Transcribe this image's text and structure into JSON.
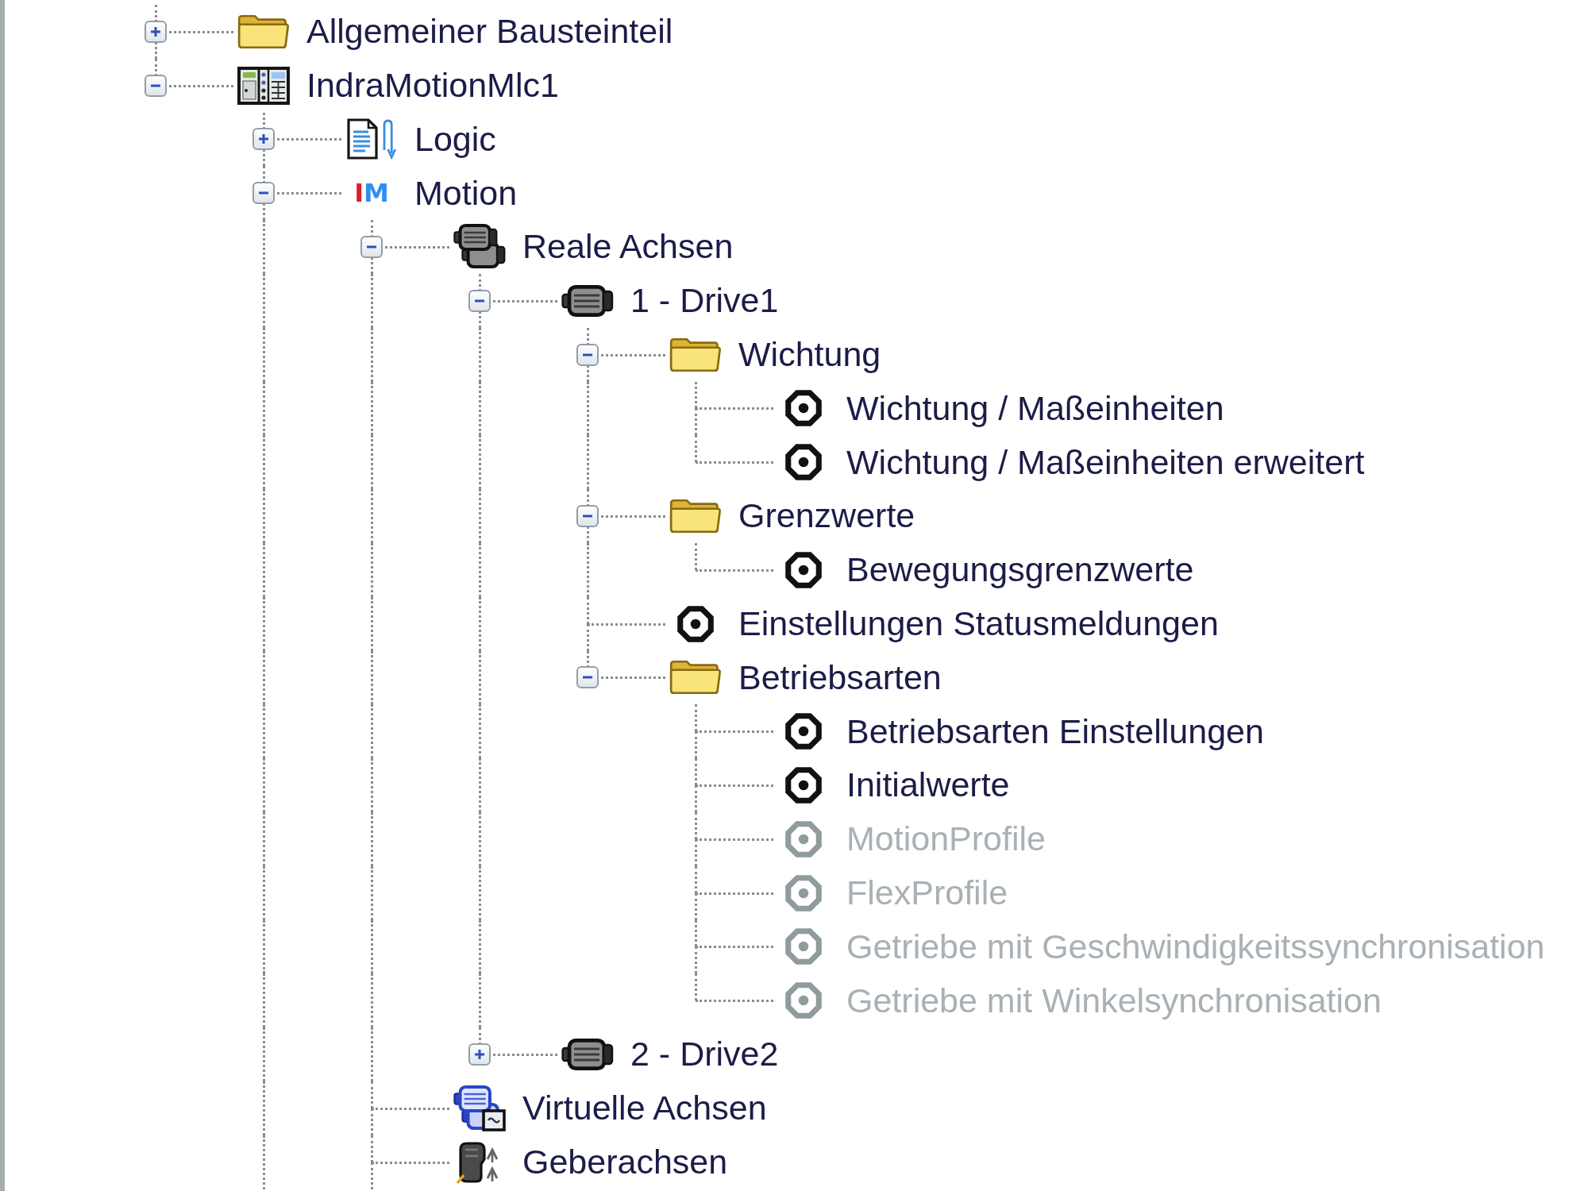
{
  "tree": {
    "items": [
      {
        "label": "Allgemeiner Bausteinteil",
        "kind": "folder",
        "expanded": false,
        "disabled": false
      },
      {
        "label": "IndraMotionMlc1",
        "kind": "controller",
        "expanded": true,
        "children_continue": true,
        "disabled": false,
        "children": [
          {
            "label": "Logic",
            "kind": "program",
            "expanded": false,
            "disabled": false
          },
          {
            "label": "Motion",
            "kind": "logo",
            "logo": "IM",
            "expanded": true,
            "children_continue": true,
            "disabled": false,
            "children": [
              {
                "label": "Reale Achsen",
                "kind": "axis-group",
                "expanded": true,
                "children_continue": false,
                "disabled": false,
                "children": [
                  {
                    "label": "1 - Drive1",
                    "kind": "drive",
                    "expanded": true,
                    "children_continue": false,
                    "disabled": false,
                    "children": [
                      {
                        "label": "Wichtung",
                        "kind": "folder",
                        "expanded": true,
                        "children_continue": false,
                        "disabled": false,
                        "children": [
                          {
                            "label": "Wichtung / Maßeinheiten",
                            "kind": "parameter",
                            "disabled": false
                          },
                          {
                            "label": "Wichtung / Maßeinheiten erweitert",
                            "kind": "parameter",
                            "disabled": false
                          }
                        ]
                      },
                      {
                        "label": "Grenzwerte",
                        "kind": "folder",
                        "expanded": true,
                        "children_continue": false,
                        "disabled": false,
                        "children": [
                          {
                            "label": "Bewegungsgrenzwerte",
                            "kind": "parameter",
                            "disabled": false
                          }
                        ]
                      },
                      {
                        "label": "Einstellungen Statusmeldungen",
                        "kind": "parameter",
                        "disabled": false
                      },
                      {
                        "label": "Betriebsarten",
                        "kind": "folder",
                        "expanded": true,
                        "children_continue": false,
                        "disabled": false,
                        "children": [
                          {
                            "label": "Betriebsarten Einstellungen",
                            "kind": "parameter",
                            "disabled": false
                          },
                          {
                            "label": "Initialwerte",
                            "kind": "parameter",
                            "disabled": false
                          },
                          {
                            "label": "MotionProfile",
                            "kind": "parameter",
                            "disabled": true
                          },
                          {
                            "label": "FlexProfile",
                            "kind": "parameter",
                            "disabled": true
                          },
                          {
                            "label": "Getriebe mit Geschwindigkeitssynchronisation",
                            "kind": "parameter",
                            "disabled": true
                          },
                          {
                            "label": "Getriebe mit Winkelsynchronisation",
                            "kind": "parameter",
                            "disabled": true
                          }
                        ]
                      }
                    ]
                  },
                  {
                    "label": "2 - Drive2",
                    "kind": "drive",
                    "expanded": false,
                    "disabled": false
                  }
                ]
              },
              {
                "label": "Virtuelle Achsen",
                "kind": "virtual-axis-group",
                "disabled": false
              },
              {
                "label": "Geberachsen",
                "kind": "encoder-axis-group",
                "disabled": false
              }
            ]
          }
        ]
      }
    ]
  }
}
